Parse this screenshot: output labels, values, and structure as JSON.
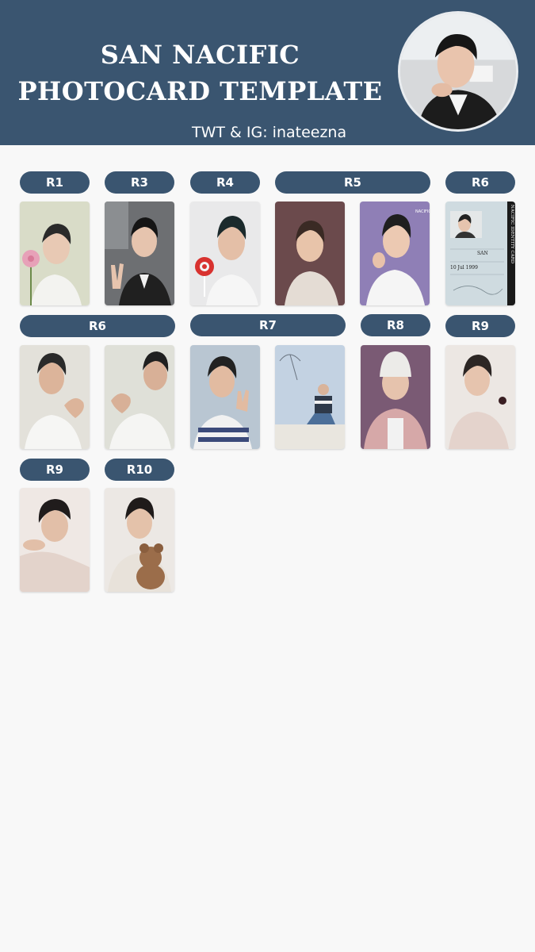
{
  "header": {
    "title_line1": "SAN NACIFIC",
    "title_line2": "PHOTOCARD TEMPLATE",
    "subtitle": "TWT & IG: inateezna",
    "bg_color": "#3a5570",
    "avatar_icon": "profile-photo"
  },
  "labels": {
    "r1": "R1",
    "r3": "R3",
    "r4": "R4",
    "r5": "R5",
    "r6_top": "R6",
    "r6_mid": "R6",
    "r7": "R7",
    "r8": "R8",
    "r9_mid": "R9",
    "r9_bottom": "R9",
    "r10": "R10"
  },
  "id_card": {
    "heading": "NACIFIC IDENTITY CARD",
    "name": "SAN",
    "date": "10 Jul 1999"
  }
}
